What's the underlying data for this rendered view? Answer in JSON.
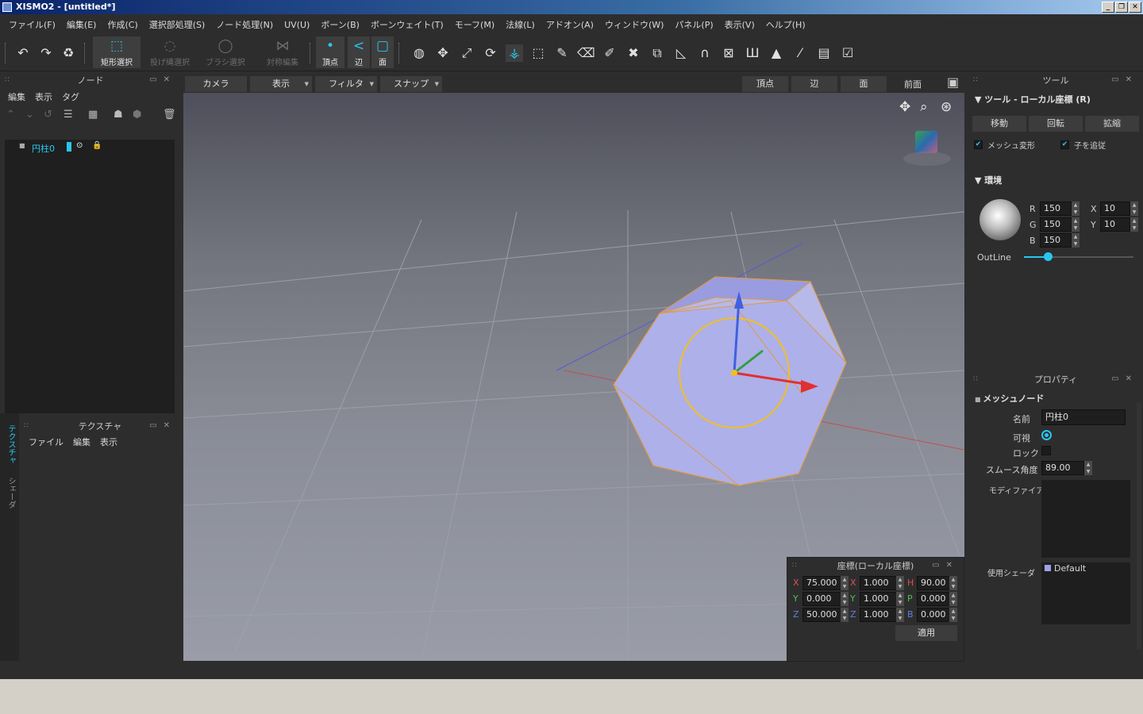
{
  "window": {
    "title": "XISMO2 - [untitled*]",
    "controls": [
      "_",
      "❐",
      "✕"
    ]
  },
  "menu": [
    "ファイル(F)",
    "編集(E)",
    "作成(C)",
    "選択部処理(S)",
    "ノード処理(N)",
    "UV(U)",
    "ボーン(B)",
    "ボーンウェイト(T)",
    "モーフ(M)",
    "法線(L)",
    "アドオン(A)",
    "ウィンドウ(W)",
    "パネル(P)",
    "表示(V)",
    "ヘルプ(H)"
  ],
  "toolbar": {
    "rect_select": "矩形選択",
    "lasso_select": "投げ縄選択",
    "brush_select": "ブラシ選択",
    "symmetry_edit": "対称編集",
    "vertex": "頂点",
    "edge": "辺",
    "face": "面"
  },
  "node_panel": {
    "title": "ノード",
    "menu": [
      "編集",
      "表示",
      "タグ"
    ],
    "tree": [
      {
        "name": "円柱0"
      }
    ]
  },
  "texture_panel": {
    "title": "テクスチャ",
    "menu": [
      "ファイル",
      "編集",
      "表示"
    ],
    "side_tabs": [
      "テクスチャ",
      "シェーダ"
    ]
  },
  "viewport_bar": {
    "camera": "カメラ",
    "display": "表示",
    "filter": "フィルタ",
    "snap": "スナップ",
    "vertex": "頂点",
    "edge": "辺",
    "face": "面",
    "view_name": "前面"
  },
  "coords_panel": {
    "title": "座標(ローカル座標)",
    "rows": [
      {
        "a": "X",
        "av": "75.000",
        "b": "X",
        "bv": "1.000",
        "c": "H",
        "cv": "90.00"
      },
      {
        "a": "Y",
        "av": "0.000",
        "b": "Y",
        "bv": "1.000",
        "c": "P",
        "cv": "0.000"
      },
      {
        "a": "Z",
        "av": "50.000",
        "b": "Z",
        "bv": "1.000",
        "c": "B",
        "cv": "0.000"
      }
    ],
    "apply": "適用"
  },
  "tool_panel": {
    "title": "ツール",
    "section": "ツール - ローカル座標 (R)",
    "tabs": [
      "移動",
      "回転",
      "拡縮"
    ],
    "mesh_deform": "メッシュ変形",
    "follow_children": "子を追従",
    "env": {
      "title": "環境",
      "R": "150",
      "G": "150",
      "B": "150",
      "X": "10",
      "Y": "10",
      "outline": "OutLine",
      "outline_level": 0.22
    }
  },
  "props_panel": {
    "title": "プロパティ",
    "section": "メッシュノード",
    "name_label": "名前",
    "name_value": "円柱0",
    "visible_label": "可視",
    "lock_label": "ロック",
    "smooth_label": "スムース角度",
    "smooth_value": "89.00",
    "modifier_label": "モディファイア",
    "shader_label": "使用シェーダ",
    "shader_value": "Default"
  },
  "colors": {
    "accent": "#27c7f0",
    "bg": "#2d2d2d",
    "dark": "#1e1e1e"
  }
}
